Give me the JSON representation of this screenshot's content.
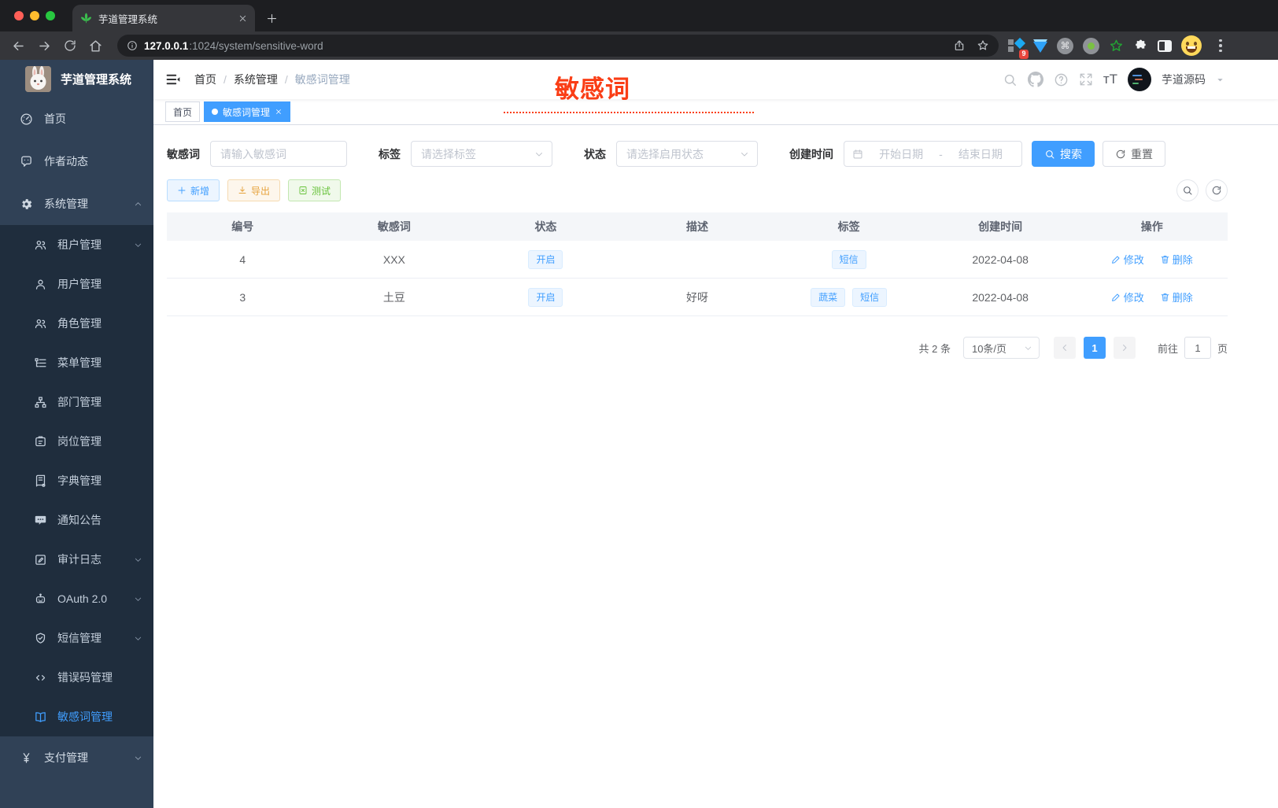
{
  "colors": {
    "primary": "#409eff",
    "sidebar_bg": "#304156",
    "submenu_bg": "#1f2d3d",
    "annotation_red": "#fa3e16",
    "warning": "#e6a23c",
    "success": "#67c23a",
    "tag_bg": "#ecf5ff"
  },
  "browser": {
    "tab_title": "芋道管理系统",
    "url_host": "127.0.0.1",
    "url_path": ":1024/system/sensitive-word",
    "extension_badge": "9"
  },
  "icons": {
    "cmd": "⌘",
    "fontsize": "тT"
  },
  "sidebar": {
    "logo_title": "芋道管理系统",
    "items": [
      {
        "label": "首页"
      },
      {
        "label": "作者动态"
      },
      {
        "label": "系统管理"
      }
    ],
    "system_children": [
      {
        "label": "租户管理"
      },
      {
        "label": "用户管理"
      },
      {
        "label": "角色管理"
      },
      {
        "label": "菜单管理"
      },
      {
        "label": "部门管理"
      },
      {
        "label": "岗位管理"
      },
      {
        "label": "字典管理"
      },
      {
        "label": "通知公告"
      },
      {
        "label": "审计日志"
      },
      {
        "label": "OAuth 2.0"
      },
      {
        "label": "短信管理"
      },
      {
        "label": "错误码管理"
      },
      {
        "label": "敏感词管理"
      }
    ],
    "bottom_items": [
      {
        "label": "支付管理"
      }
    ]
  },
  "navbar": {
    "breadcrumb": [
      "首页",
      "系统管理",
      "敏感词管理"
    ],
    "separator": "/",
    "annotation": "敏感词",
    "username": "芋道源码"
  },
  "tags_view": {
    "tabs": [
      {
        "label": "首页"
      },
      {
        "label": "敏感词管理"
      }
    ]
  },
  "filters": {
    "keyword_label": "敏感词",
    "keyword_placeholder": "请输入敏感词",
    "tag_label": "标签",
    "tag_placeholder": "请选择标签",
    "status_label": "状态",
    "status_placeholder": "请选择启用状态",
    "date_label": "创建时间",
    "date_start_placeholder": "开始日期",
    "date_separator": "-",
    "date_end_placeholder": "结束日期",
    "search_label": "搜索",
    "reset_label": "重置"
  },
  "toolbar": {
    "add_label": "新增",
    "export_label": "导出",
    "test_label": "测试"
  },
  "table": {
    "headers": [
      "编号",
      "敏感词",
      "状态",
      "描述",
      "标签",
      "创建时间",
      "操作"
    ],
    "rows": [
      {
        "id": "4",
        "word": "XXX",
        "status": "开启",
        "description": "",
        "tags": [
          "短信"
        ],
        "created": "2022-04-08"
      },
      {
        "id": "3",
        "word": "土豆",
        "status": "开启",
        "description": "好呀",
        "tags": [
          "蔬菜",
          "短信"
        ],
        "created": "2022-04-08"
      }
    ],
    "edit_label": "修改",
    "delete_label": "删除"
  },
  "pagination": {
    "total_text": "共 2 条",
    "page_size": "10条/页",
    "current_page": "1",
    "goto_label": "前往",
    "goto_value": "1",
    "page_unit": "页"
  }
}
